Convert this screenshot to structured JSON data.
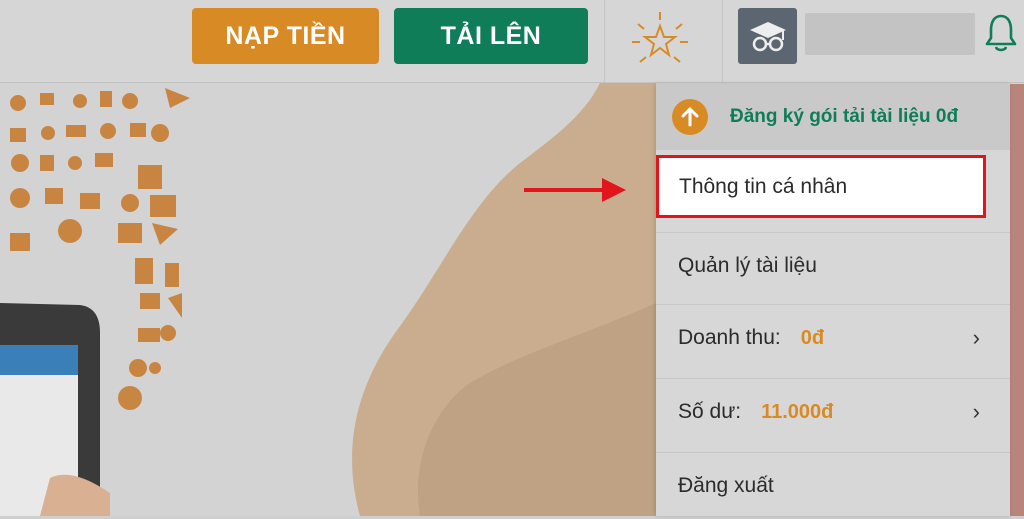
{
  "header": {
    "nap_tien_label": "NẠP TIỀN",
    "tai_len_label": "TẢI LÊN"
  },
  "menu": {
    "register_package": "Đăng ký gói tải tài liệu 0đ",
    "personal_info": "Thông tin cá nhân",
    "manage_docs": "Quản lý tài liệu",
    "revenue_label": "Doanh thu:",
    "revenue_value": "0đ",
    "balance_label": "Số dư:",
    "balance_value": "11.000đ",
    "logout": "Đăng xuất"
  },
  "colors": {
    "orange": "#d88b25",
    "green": "#0f7d58",
    "highlight_border": "#e3151c"
  },
  "icons": [
    "star-icon",
    "avatar-icon",
    "bell-icon",
    "arrow-up-icon",
    "chevron-right-icon"
  ]
}
